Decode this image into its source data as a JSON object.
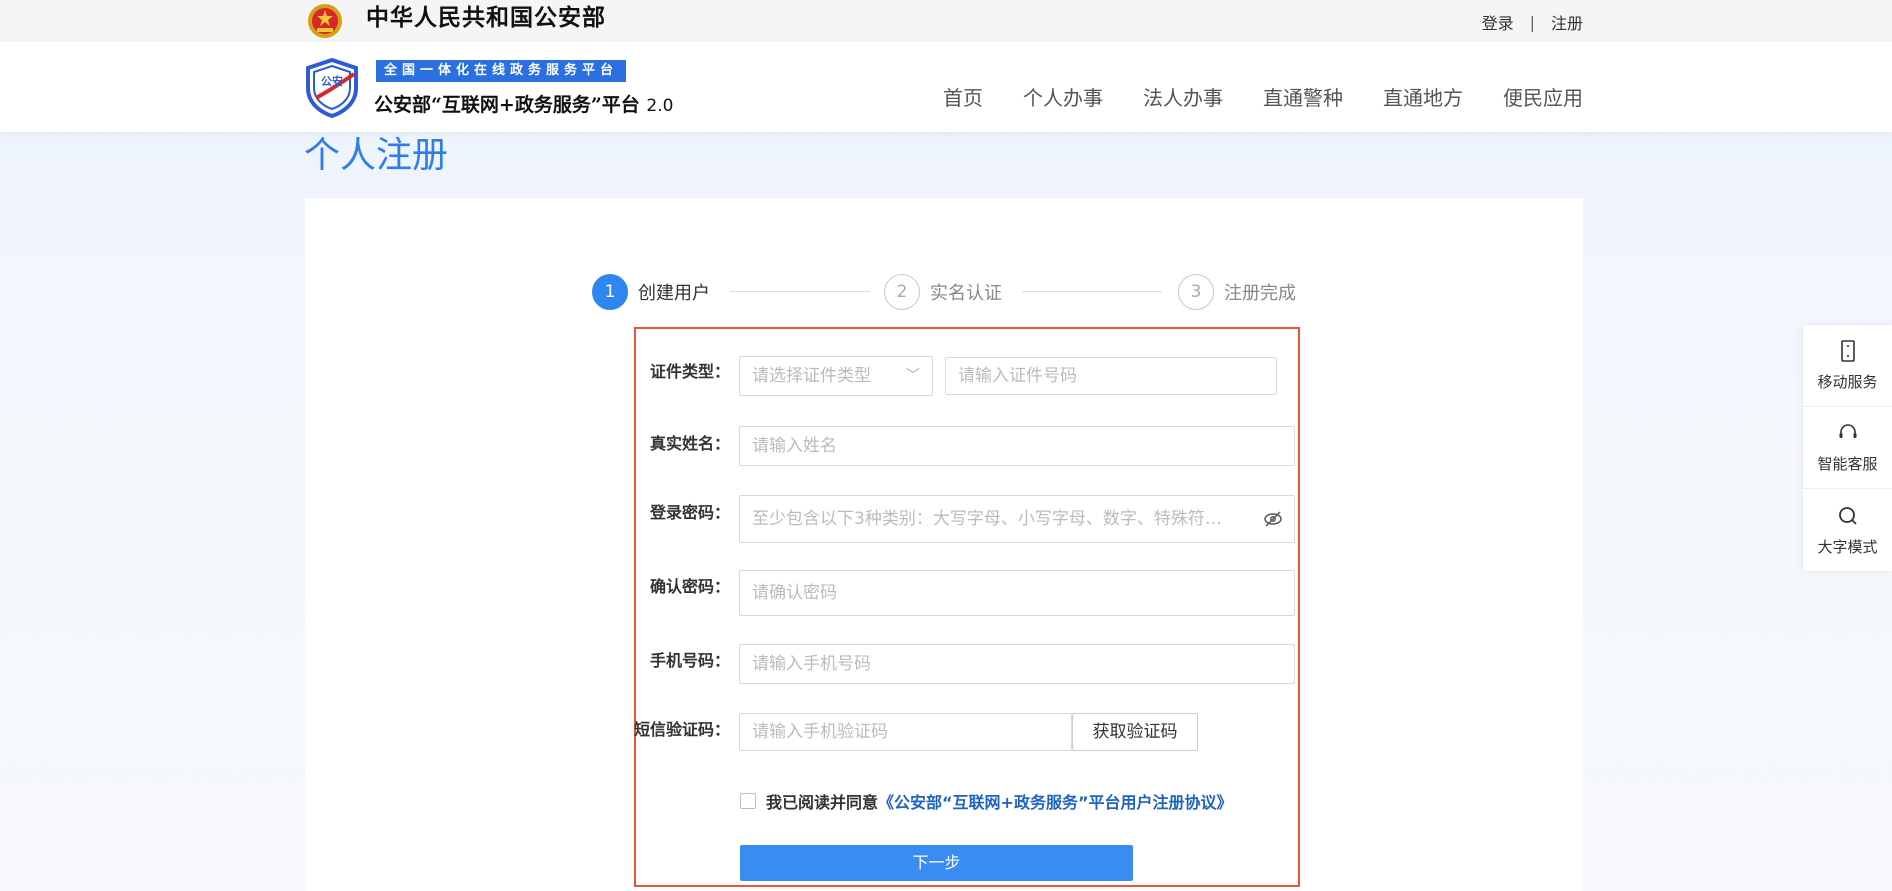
{
  "topbar": {
    "ministry": "中华人民共和国公安部",
    "login": "登录",
    "separator": "|",
    "register": "注册"
  },
  "header": {
    "badge": "全国一体化在线政务服务平台",
    "platform_name": "公安部“互联网+政务服务”平台",
    "version": "2.0",
    "logo_text": "公安",
    "nav": [
      "首页",
      "个人办事",
      "法人办事",
      "直通警种",
      "直通地方",
      "便民应用"
    ]
  },
  "page": {
    "title": "个人注册"
  },
  "steps": [
    {
      "num": "1",
      "label": "创建用户",
      "active": true
    },
    {
      "num": "2",
      "label": "实名认证",
      "active": false
    },
    {
      "num": "3",
      "label": "注册完成",
      "active": false
    }
  ],
  "form": {
    "id_type_label": "证件类型：",
    "id_type_placeholder": "请选择证件类型",
    "id_number_placeholder": "请输入证件号码",
    "name_label": "真实姓名：",
    "name_placeholder": "请输入姓名",
    "password_label": "登录密码：",
    "password_placeholder": "至少包含以下3种类别：大写字母、小写字母、数字、特殊符…",
    "confirm_label": "确认密码：",
    "confirm_placeholder": "请确认密码",
    "phone_label": "手机号码：",
    "phone_placeholder": "请输入手机号码",
    "sms_label": "短信验证码：",
    "sms_placeholder": "请输入手机验证码",
    "sms_button": "获取验证码",
    "agree_text": "我已阅读并同意",
    "agree_link": "《公安部“互联网+政务服务”平台用户注册协议》",
    "next_button": "下一步"
  },
  "side_panel": [
    {
      "label": "移动服务",
      "icon": "mobile-icon"
    },
    {
      "label": "智能客服",
      "icon": "headset-icon"
    },
    {
      "label": "大字模式",
      "icon": "magnifier-icon"
    }
  ],
  "colors": {
    "accent": "#2f86f0",
    "title_blue": "#2f7de8",
    "highlight_border": "#e9553a",
    "link": "#1e63c4"
  }
}
